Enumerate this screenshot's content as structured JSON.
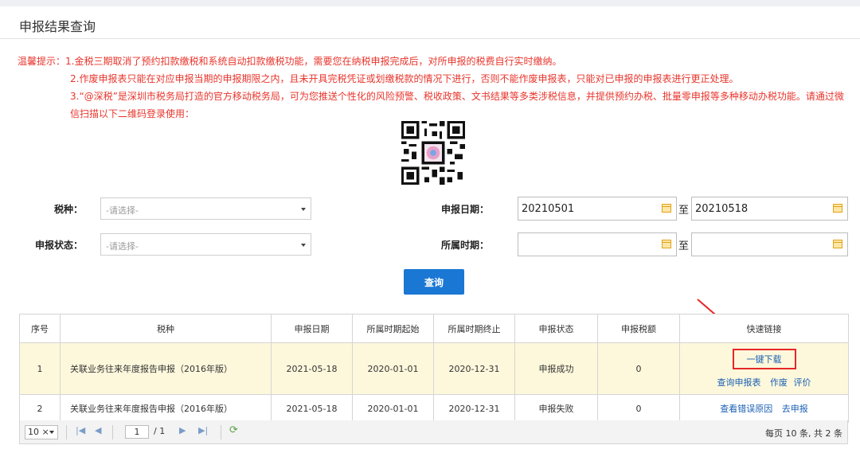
{
  "page": {
    "title": "申报结果查询"
  },
  "tips": {
    "line1": "温馨提示：1.金税三期取消了预约扣款缴税和系统自动扣款缴税功能，需要您在纳税申报完成后，对所申报的税费自行实时缴纳。",
    "line2": "2.作废申报表只能在对应申报当期的申报期限之内，且未开具完税凭证或划缴税款的情况下进行，否则不能作废申报表，只能对已申报的申报表进行更正处理。",
    "line3": "3.“@深税”是深圳市税务局打造的官方移动税务局，可为您推送个性化的风险预警、税收政策、文书结果等多类涉税信息，并提供预约办税、批量零申报等多种移动办税功能。请通过微信扫描以下二维码登录使用："
  },
  "form": {
    "tax_type_label": "税种：",
    "tax_type_placeholder": "-请选择-",
    "status_label": "申报状态：",
    "status_placeholder": "-请选择-",
    "date_label": "申报日期：",
    "date_from": "20210501",
    "date_to": "20210518",
    "period_label": "所属时期：",
    "period_from": "",
    "period_to": "",
    "to_text": "至",
    "query_button": "查询"
  },
  "table": {
    "headers": [
      "序号",
      "税种",
      "申报日期",
      "所属时期起始",
      "所属时期终止",
      "申报状态",
      "申报税额",
      "快速链接"
    ],
    "rows": [
      {
        "no": "1",
        "tax_type": "关联业务往来年度报告申报（2016年版）",
        "declare_date": "2021-05-18",
        "period_start": "2020-01-01",
        "period_end": "2020-12-31",
        "status": "申报成功",
        "amount": "0",
        "links": [
          "一键下载",
          "查询申报表",
          "作废",
          "评价"
        ]
      },
      {
        "no": "2",
        "tax_type": "关联业务往来年度报告申报（2016年版）",
        "declare_date": "2021-05-18",
        "period_start": "2020-01-01",
        "period_end": "2020-12-31",
        "status": "申报失败",
        "amount": "0",
        "links": [
          "查看错误原因",
          "去申报"
        ]
      }
    ]
  },
  "pager": {
    "page_size": "10",
    "page_size_suffix": "×",
    "current_page": "1",
    "total_pages": "/ 1",
    "info": "每页 10 条, 共 2 条"
  },
  "colors": {
    "tip_red": "#e8352c",
    "link_blue": "#1a5fb4",
    "button_blue": "#1a78d4",
    "highlight_row": "#fdf8dc",
    "annotation_red": "#e52727"
  },
  "icons": {
    "qr": "qr-code",
    "calendar": "calendar-icon",
    "dropdown": "chevron-down-icon",
    "refresh": "refresh-icon",
    "annotation": "red-arrow-annotation"
  }
}
